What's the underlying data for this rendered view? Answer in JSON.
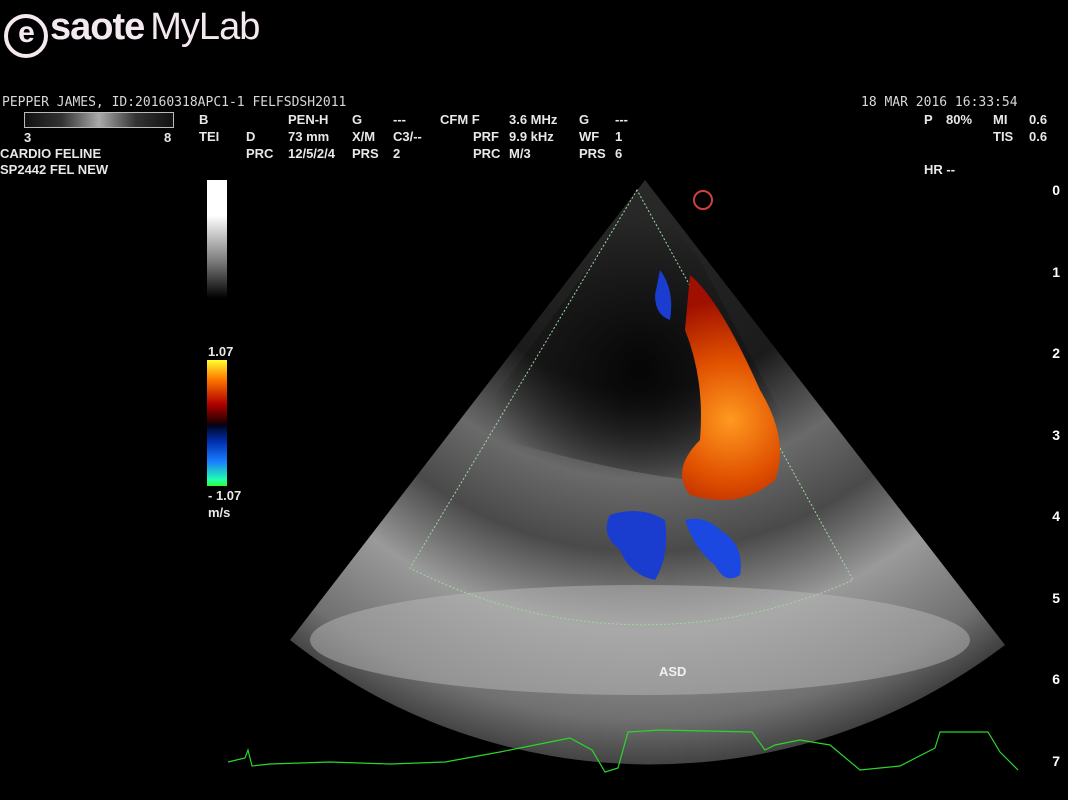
{
  "brand": {
    "logo_e": "e",
    "logo_word": "saote",
    "logo_product": "MyLab"
  },
  "patient": {
    "line": "PEPPER JAMES, ID:20160318APC1-1  FELFSDSH2011",
    "date": "18  MAR  2016 16:33:54"
  },
  "gray_scale": {
    "min": "3",
    "max": "8"
  },
  "preset": {
    "line1": "CARDIO FELINE",
    "line2": "SP2442  FEL NEW"
  },
  "params": {
    "b": "B",
    "tei": "TEI",
    "d": "D",
    "prc": "PRC",
    "pen": "PEN-H",
    "mm": "73 mm",
    "prc_val": "12/5/2/4",
    "g": "G",
    "g_val": "---",
    "xm": "X/M",
    "xm_val": "C3/--",
    "prs": "PRS",
    "prs_val": "2",
    "cfm": "CFM F",
    "cfm_val": "3.6 MHz",
    "prf": "PRF",
    "prf_val": "9.9 kHz",
    "prc2": "PRC",
    "prc2_val": "M/3",
    "g2": "G",
    "g2_val": "---",
    "wf": "WF",
    "wf_val": "1",
    "prs2": "PRS",
    "prs2_val": "6",
    "p": "P",
    "p_val": "80%",
    "mi": "MI",
    "mi_val": "0.6",
    "tis": "TIS",
    "tis_val": "0.6",
    "hr": "HR --"
  },
  "velocity_scale": {
    "max": "1.07",
    "min": "- 1.07",
    "unit": "m/s"
  },
  "image_label": "ASD",
  "depth_scale": [
    "0",
    "1",
    "2",
    "3",
    "4",
    "5",
    "6",
    "7"
  ],
  "colors": {
    "ecg": "#2bd62b",
    "roi": "#9fd89f"
  }
}
